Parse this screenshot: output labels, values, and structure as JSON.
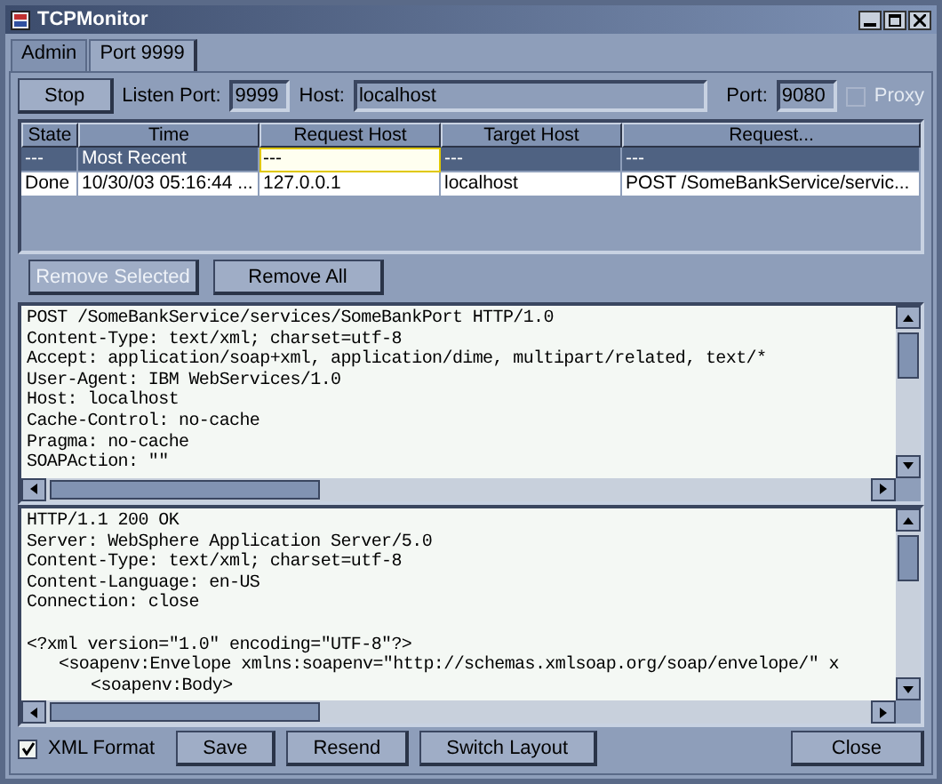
{
  "window": {
    "title": "TCPMonitor"
  },
  "tabs": [
    {
      "label": "Admin",
      "selected": false
    },
    {
      "label": "Port 9999",
      "selected": true
    }
  ],
  "toolbar": {
    "stop_button": "Stop",
    "listen_port": {
      "label": "Listen Port:",
      "value": "9999"
    },
    "host": {
      "label": "Host:",
      "value": "localhost"
    },
    "port": {
      "label": "Port:",
      "value": "9080"
    },
    "proxy": {
      "label": "Proxy",
      "checked": false,
      "disabled": true
    }
  },
  "table": {
    "columns": [
      "State",
      "Time",
      "Request Host",
      "Target Host",
      "Request..."
    ],
    "rows": [
      {
        "selected": true,
        "cells": [
          {
            "text": "---",
            "focused": false
          },
          {
            "text": "Most Recent",
            "focused": false
          },
          {
            "text": "---",
            "focused": true
          },
          {
            "text": "---",
            "focused": false
          },
          {
            "text": "---",
            "focused": false
          }
        ]
      },
      {
        "selected": false,
        "cells": [
          {
            "text": "Done",
            "focused": false
          },
          {
            "text": "10/30/03 05:16:44 ...",
            "focused": false
          },
          {
            "text": "127.0.0.1",
            "focused": false
          },
          {
            "text": "localhost",
            "focused": false
          },
          {
            "text": "POST /SomeBankService/servic...",
            "focused": false
          }
        ]
      }
    ]
  },
  "actions": [
    {
      "label": "Remove Selected",
      "disabled": true
    },
    {
      "label": "Remove All",
      "disabled": false
    }
  ],
  "request_pane": {
    "lines": [
      "POST /SomeBankService/services/SomeBankPort HTTP/1.0",
      "Content-Type: text/xml; charset=utf-8",
      "Accept: application/soap+xml, application/dime, multipart/related, text/*",
      "User-Agent: IBM WebServices/1.0",
      "Host: localhost",
      "Cache-Control: no-cache",
      "Pragma: no-cache",
      "SOAPAction: \"\""
    ]
  },
  "response_pane": {
    "headers": [
      "HTTP/1.1 200 OK",
      "Server: WebSphere Application Server/5.0",
      "Content-Type: text/xml; charset=utf-8",
      "Content-Language: en-US",
      "Connection: close"
    ],
    "body": [
      {
        "text": "<?xml version=\"1.0\" encoding=\"UTF-8\"?>",
        "children": [
          {
            "text": "<soapenv:Envelope xmlns:soapenv=\"http://schemas.xmlsoap.org/soap/envelope/\" x",
            "children": [
              {
                "text": "<soapenv:Body>"
              }
            ]
          }
        ]
      }
    ]
  },
  "footer": {
    "xml_format": {
      "label": "XML Format",
      "checked": true
    },
    "buttons": [
      "Save",
      "Resend",
      "Switch Layout"
    ],
    "close_button": "Close"
  }
}
